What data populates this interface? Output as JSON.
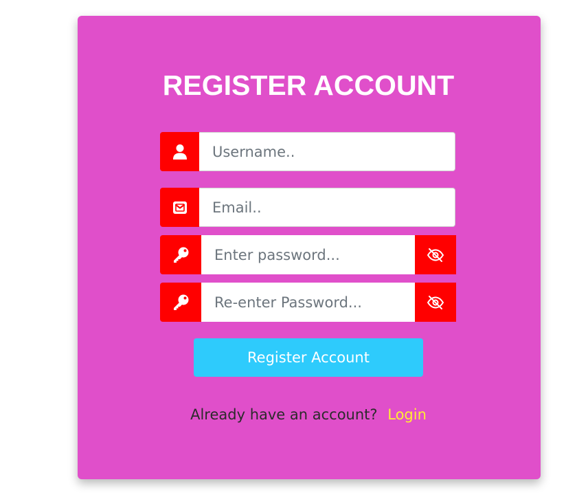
{
  "form": {
    "title": "REGISTER ACCOUNT",
    "username": {
      "placeholder": "Username..",
      "icon": "user-icon"
    },
    "email": {
      "placeholder": "Email..",
      "icon": "envelope-icon"
    },
    "password": {
      "placeholder": "Enter password...",
      "icon": "key-icon",
      "toggle_icon": "eye-slash-icon"
    },
    "confirm_password": {
      "placeholder": "Re-enter Password...",
      "icon": "key-icon",
      "toggle_icon": "eye-slash-icon"
    },
    "submit_label": "Register Account",
    "login_prompt": "Already have an account?",
    "login_link": "Login"
  },
  "colors": {
    "card_background": "#e04fca",
    "icon_background": "#ff0000",
    "button_background": "#2ecbfc",
    "link_color": "#ffee33",
    "title_color": "#ffffff"
  }
}
